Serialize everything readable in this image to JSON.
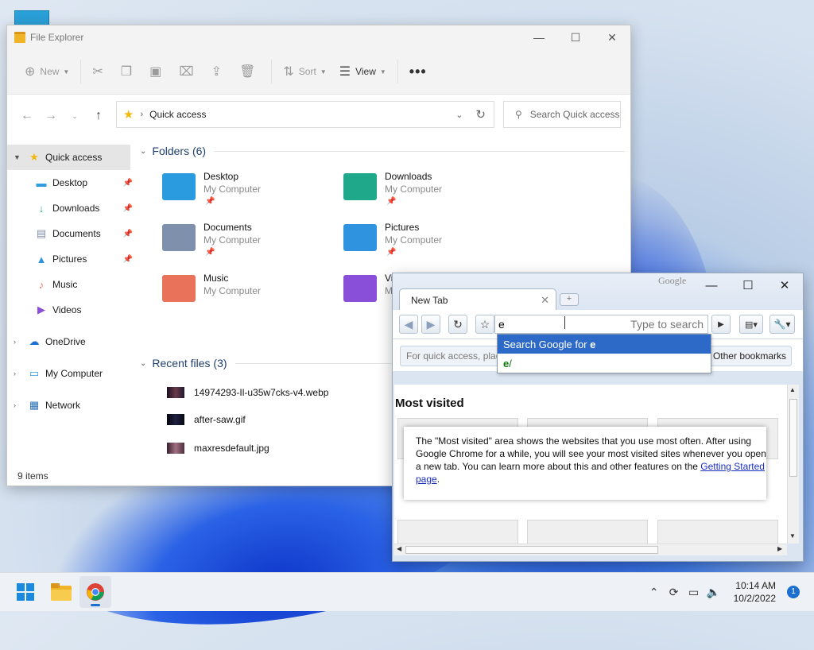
{
  "explorer": {
    "title": "File Explorer",
    "controls": {
      "minimize": "—",
      "maximize": "☐",
      "close": "✕"
    },
    "toolbar": {
      "new_label": "New",
      "sort_label": "Sort",
      "view_label": "View",
      "more_label": "•••"
    },
    "address": {
      "path": "Quick access"
    },
    "search": {
      "placeholder": "Search Quick access"
    },
    "sidebar": {
      "quick_access": "Quick access",
      "pinned": [
        {
          "label": "Desktop"
        },
        {
          "label": "Downloads"
        },
        {
          "label": "Documents"
        },
        {
          "label": "Pictures"
        },
        {
          "label": "Music"
        },
        {
          "label": "Videos"
        }
      ],
      "onedrive": "OneDrive",
      "my_computer": "My Computer",
      "network": "Network"
    },
    "folders_header": "Folders (6)",
    "folders": [
      {
        "name": "Desktop",
        "sub": "My Computer",
        "color": "#2b9be0"
      },
      {
        "name": "Downloads",
        "sub": "My Computer",
        "color": "#1fa88a"
      },
      {
        "name": "Documents",
        "sub": "My Computer",
        "color": "#7e90ab"
      },
      {
        "name": "Pictures",
        "sub": "My Computer",
        "color": "#2f93e0"
      },
      {
        "name": "Music",
        "sub": "My Computer",
        "color": "#e8735a"
      },
      {
        "name": "Vi",
        "sub": "M",
        "color": "#8a4fd8"
      }
    ],
    "recent_header": "Recent files (3)",
    "recent": [
      {
        "name": "14974293-Il-u35w7cks-v4.webp"
      },
      {
        "name": "after-saw.gif"
      },
      {
        "name": "maxresdefault.jpg"
      }
    ],
    "status": "9 items"
  },
  "chrome": {
    "brand": "Google",
    "tab_title": "New Tab",
    "tab_close": "✕",
    "newtab_label": "+",
    "omnibox": {
      "value": "e",
      "hint": "Type to search"
    },
    "dropdown": {
      "search_prefix": "Search Google for ",
      "search_term": "e",
      "url_bold": "e",
      "url_rest": "/"
    },
    "bookmarks_hint": "For quick access, place your bookmarks here",
    "other_bookmarks": "Other bookmarks",
    "most_visited_title": "Most visited",
    "most_visited_text": "The \"Most visited\" area shows the websites that you use most often. After using Google Chrome for a while, you will see your most visited sites whenever you open a new tab. You can learn more about this and other features on the ",
    "most_visited_link": "Getting Started page",
    "most_visited_end": "."
  },
  "taskbar": {
    "time": "10:14 AM",
    "date": "10/2/2022",
    "notifications": "1"
  },
  "colors": {
    "accent": "#1a6fd1",
    "dropdown_selected": "#2d6ac7",
    "folder_yellow": "#f0b429"
  }
}
